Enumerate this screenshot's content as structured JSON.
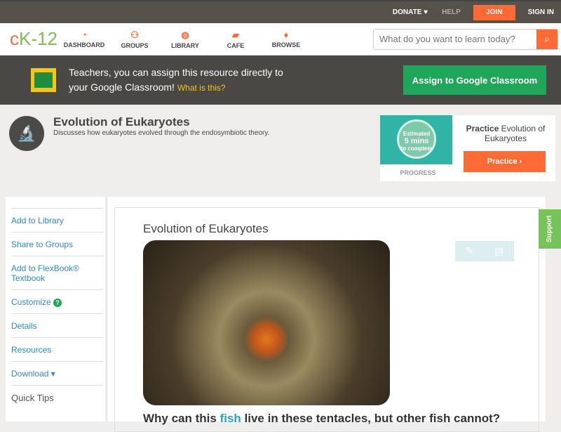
{
  "topbar": {
    "donate": "DONATE ♥",
    "help": "HELP",
    "join": "JOIN",
    "signin": "SIGN IN"
  },
  "nav": {
    "logo_c": "c",
    "logo_rest": "K-12",
    "items": [
      {
        "label": "DASHBOARD",
        "icon": "◔"
      },
      {
        "label": "GROUPS",
        "icon": "⚇"
      },
      {
        "label": "LIBRARY",
        "icon": "◍"
      },
      {
        "label": "CAFE",
        "icon": "▰"
      },
      {
        "label": "BROWSE",
        "icon": "♦"
      }
    ],
    "search_placeholder": "What do you want to learn today?",
    "search_icon": "⌕"
  },
  "banner": {
    "line1": "Teachers, you can assign this resource directly to",
    "line2": "your Google Classroom!",
    "link": "What is this?",
    "button": "Assign to Google Classroom"
  },
  "header": {
    "title": "Evolution of Eukaryotes",
    "subtitle": "Discusses how eukaryotes evolved through the endosymbiotic theory.",
    "icon": "🔬"
  },
  "practice": {
    "est1": "Estimated",
    "est2": "5 mins",
    "est3": "to complete",
    "progress": "PROGRESS",
    "bold": "Practice",
    "title": " Evolution of Eukaryotes",
    "button": "Practice ›"
  },
  "sidebar": {
    "items": [
      "Add to Library",
      "Share to Groups",
      "Add to FlexBook® Textbook",
      "Customize",
      "Details",
      "Resources",
      "Download ▾"
    ],
    "help_badge": "?",
    "quick_tips": "Quick Tips"
  },
  "content": {
    "title": "Evolution of Eukaryotes",
    "q_pre": "Why can this ",
    "q_link": "fish",
    "q_post": " live in these tentacles, but other fish cannot?",
    "tools": [
      "✎",
      "▤"
    ]
  },
  "support": "Support"
}
